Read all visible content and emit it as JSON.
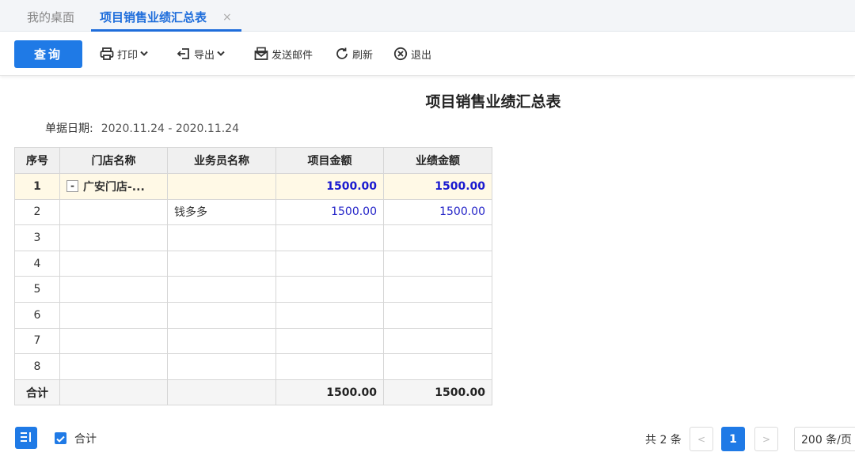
{
  "tabs": {
    "home": "我的桌面",
    "active": "项目销售业绩汇总表",
    "close": "×"
  },
  "toolbar": {
    "query": "查询",
    "print": "打印",
    "export": "导出",
    "email": "发送邮件",
    "refresh": "刷新",
    "exit": "退出"
  },
  "report": {
    "title": "项目销售业绩汇总表",
    "date_label": "单据日期:",
    "date_value": "2020.11.24 - 2020.11.24"
  },
  "table": {
    "headers": [
      "序号",
      "门店名称",
      "业务员名称",
      "项目金额",
      "业绩金额"
    ],
    "rows": [
      {
        "idx": "1",
        "toggle": "-",
        "store": "广安门店-...",
        "staff": "",
        "project_amount": "1500.00",
        "perf_amount": "1500.00"
      },
      {
        "idx": "2",
        "store": "",
        "staff": "钱多多",
        "project_amount": "1500.00",
        "perf_amount": "1500.00"
      },
      {
        "idx": "3",
        "store": "",
        "staff": "",
        "project_amount": "",
        "perf_amount": ""
      },
      {
        "idx": "4",
        "store": "",
        "staff": "",
        "project_amount": "",
        "perf_amount": ""
      },
      {
        "idx": "5",
        "store": "",
        "staff": "",
        "project_amount": "",
        "perf_amount": ""
      },
      {
        "idx": "6",
        "store": "",
        "staff": "",
        "project_amount": "",
        "perf_amount": ""
      },
      {
        "idx": "7",
        "store": "",
        "staff": "",
        "project_amount": "",
        "perf_amount": ""
      },
      {
        "idx": "8",
        "store": "",
        "staff": "",
        "project_amount": "",
        "perf_amount": ""
      }
    ],
    "summary": {
      "label": "合计",
      "project_amount": "1500.00",
      "perf_amount": "1500.00"
    }
  },
  "footer": {
    "sum_checkbox_label": "合计",
    "sum_checked": true,
    "total_text": "共 2 条",
    "prev": "<",
    "current_page": "1",
    "next": ">",
    "page_size": "200 条/页"
  },
  "colors": {
    "accent": "#1f7ae6",
    "amount": "#2424c8",
    "group_row": "#fff9e6"
  },
  "icons": [
    "print-icon",
    "export-icon",
    "email-icon",
    "refresh-icon",
    "exit-icon",
    "column-settings-icon",
    "check-icon"
  ]
}
